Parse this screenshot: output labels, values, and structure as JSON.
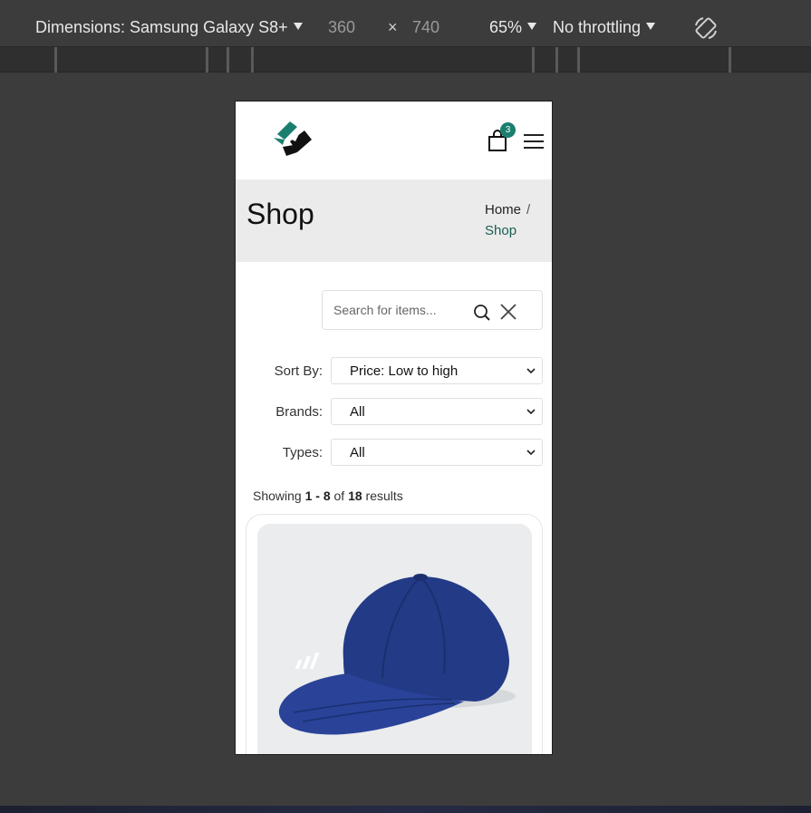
{
  "devtools": {
    "dimensions_label": "Dimensions: Samsung Galaxy S8+",
    "width_value": "360",
    "times": "×",
    "height_value": "740",
    "zoom": "65%",
    "throttling": "No throttling",
    "rotate_icon": "rotate-icon"
  },
  "site": {
    "logo_icon": "brand-logo",
    "cart_icon": "shopping-bag-icon",
    "cart_count": "3",
    "menu_icon": "hamburger-icon",
    "accent_color": "#1a7f6e"
  },
  "banner": {
    "title": "Shop",
    "breadcrumb_home": "Home",
    "breadcrumb_sep": "/",
    "breadcrumb_current": "Shop"
  },
  "search": {
    "placeholder": "Search for items...",
    "search_icon": "search-icon",
    "clear_icon": "close-icon"
  },
  "filters": {
    "sort_label": "Sort By:",
    "sort_value": "Price: Low to high",
    "brands_label": "Brands:",
    "brands_value": "All",
    "types_label": "Types:",
    "types_value": "All"
  },
  "results": {
    "prefix": "Showing",
    "range": "1 - 8",
    "of": "of",
    "total": "18",
    "suffix": "results"
  },
  "product": {
    "image_alt": "navy blue baseball cap"
  }
}
